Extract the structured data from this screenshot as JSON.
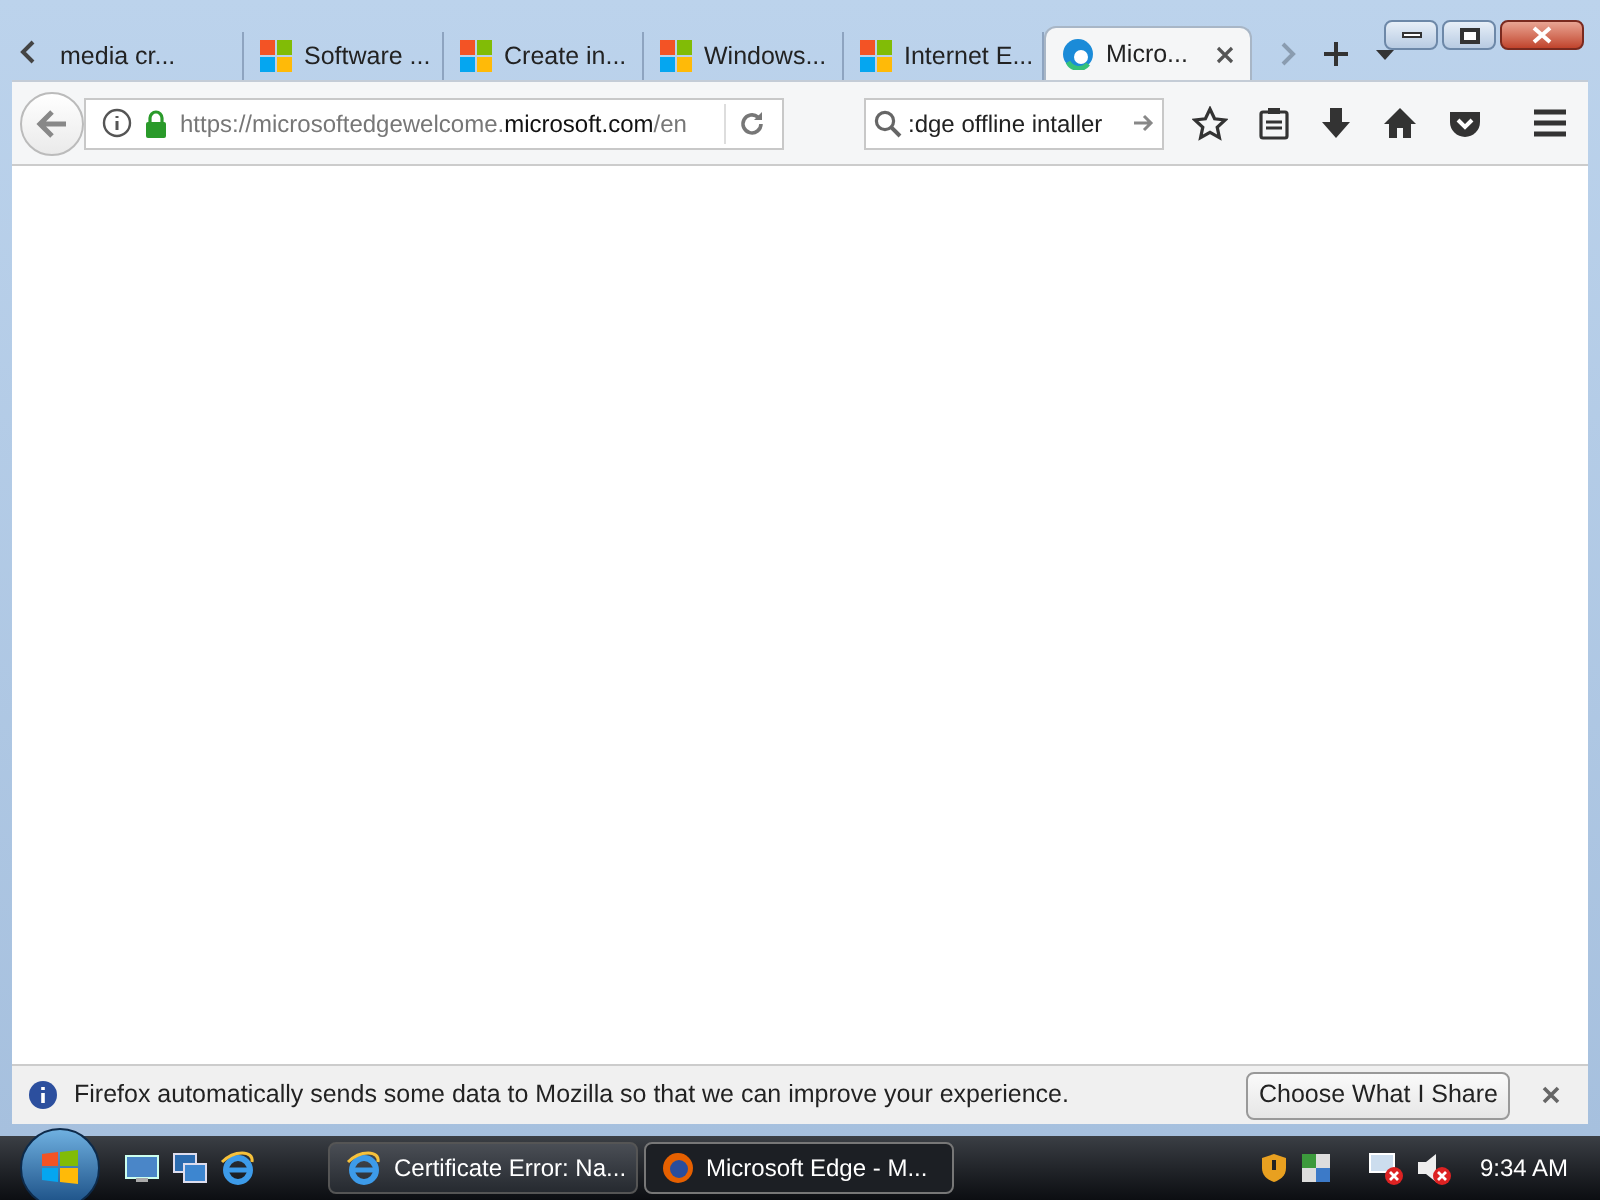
{
  "tabs": [
    {
      "label": "media cr...",
      "kind": "plain",
      "selected": false
    },
    {
      "label": "Software ...",
      "kind": "windows",
      "selected": false
    },
    {
      "label": "Create in...",
      "kind": "windows",
      "selected": false
    },
    {
      "label": "Windows...",
      "kind": "windows",
      "selected": false
    },
    {
      "label": "Internet E...",
      "kind": "windows",
      "selected": false
    },
    {
      "label": "Micro...",
      "kind": "edge",
      "selected": true
    }
  ],
  "address": {
    "prefix": "https://microsoftedgewelcome.",
    "domain": "microsoft.com",
    "path": "/en"
  },
  "search": {
    "value": ":dge offline intaller"
  },
  "notification": {
    "message": "Firefox automatically sends some data to Mozilla so that we can improve your experience.",
    "button": "Choose What I Share"
  },
  "taskbar": {
    "buttons": [
      {
        "label": "Certificate Error: Na...",
        "kind": "ie",
        "selected": false
      },
      {
        "label": "Microsoft Edge - M...",
        "kind": "firefox",
        "selected": true
      }
    ],
    "clock": "9:34 AM"
  }
}
